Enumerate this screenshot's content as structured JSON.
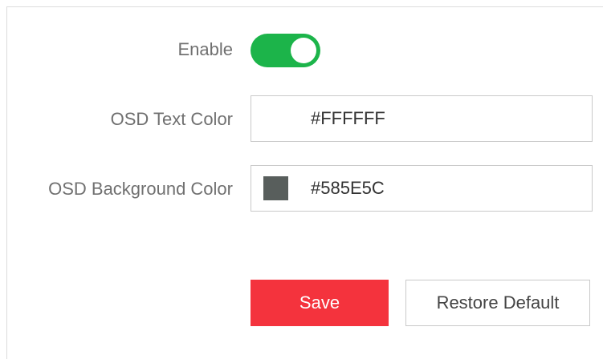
{
  "form": {
    "enable": {
      "label": "Enable",
      "value": true
    },
    "osd_text_color": {
      "label": "OSD Text Color",
      "value": "#FFFFFF",
      "swatch_color": "#FFFFFF"
    },
    "osd_background_color": {
      "label": "OSD Background Color",
      "value": "#585E5C",
      "swatch_color": "#585E5C"
    }
  },
  "actions": {
    "save_label": "Save",
    "restore_label": "Restore Default"
  },
  "colors": {
    "accent_green": "#1CB44A",
    "save_red": "#F4333D"
  }
}
